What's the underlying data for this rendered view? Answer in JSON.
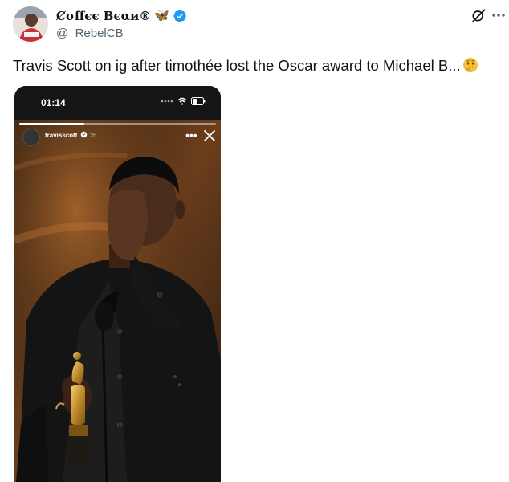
{
  "tweet": {
    "display_name": "Ȼσffєє Вєαи®",
    "badge_emoji": "🦋",
    "handle": "@_RebelCB",
    "text": "Travis Scott on ig after timothée lost the Oscar award to Michael B...",
    "icons": [
      "verified-badge-icon",
      "grok-icon",
      "more-icon",
      "thinking-face-emoji"
    ],
    "colors": {
      "verified": "#1d9bf0",
      "handle": "#536471"
    }
  },
  "story": {
    "status_time": "01:14",
    "username": "travisscott",
    "time_ago": "2h",
    "progress": 0.33
  }
}
